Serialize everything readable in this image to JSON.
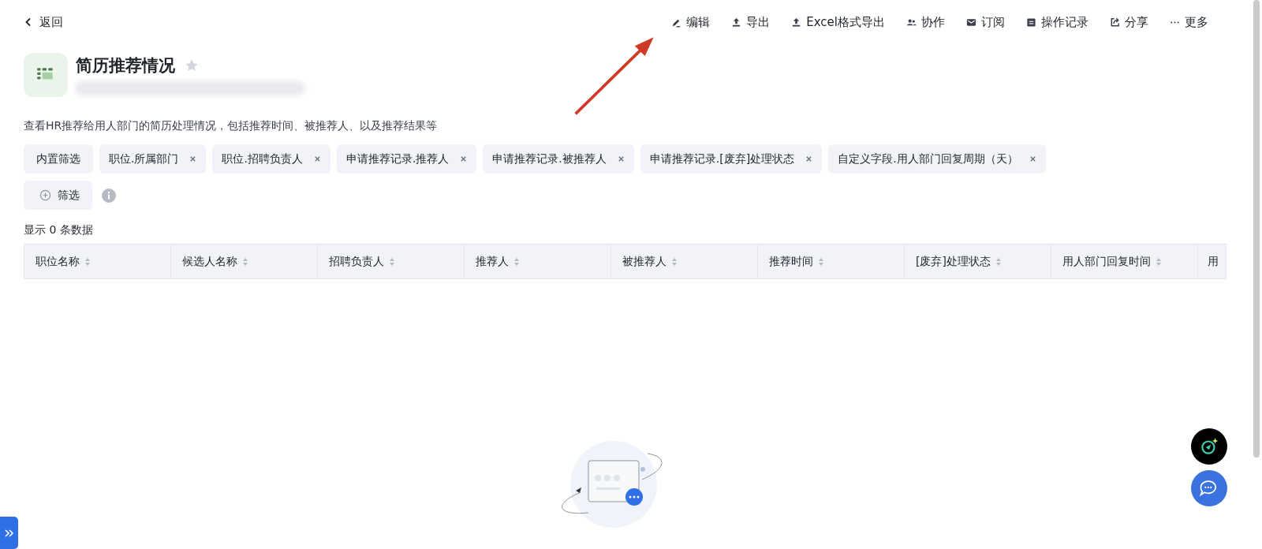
{
  "back": {
    "label": "返回"
  },
  "toolbar": [
    {
      "kind": "edit",
      "label": "编辑"
    },
    {
      "kind": "upload",
      "label": "导出"
    },
    {
      "kind": "upload",
      "label": "Excel格式导出"
    },
    {
      "kind": "people",
      "label": "协作"
    },
    {
      "kind": "mail",
      "label": "订阅"
    },
    {
      "kind": "log",
      "label": "操作记录"
    },
    {
      "kind": "share",
      "label": "分享"
    },
    {
      "kind": "more",
      "label": "更多"
    }
  ],
  "report": {
    "title": "简历推荐情况",
    "starred": false,
    "description": "查看HR推荐给用人部门的简历处理情况，包括推荐时间、被推荐人、以及推荐结果等"
  },
  "filters": {
    "preset": "内置筛选",
    "chips": [
      "职位.所属部门",
      "职位.招聘负责人",
      "申请推荐记录.推荐人",
      "申请推荐记录.被推荐人",
      "申请推荐记录.[废弃]处理状态",
      "自定义字段.用人部门回复周期（天）"
    ],
    "add": "筛选"
  },
  "count": "显示 0 条数据",
  "table": {
    "columns": [
      "职位名称",
      "候选人名称",
      "招聘负责人",
      "推荐人",
      "被推荐人",
      "推荐时间",
      "[废弃]处理状态",
      "用人部门回复时间",
      "用"
    ]
  }
}
